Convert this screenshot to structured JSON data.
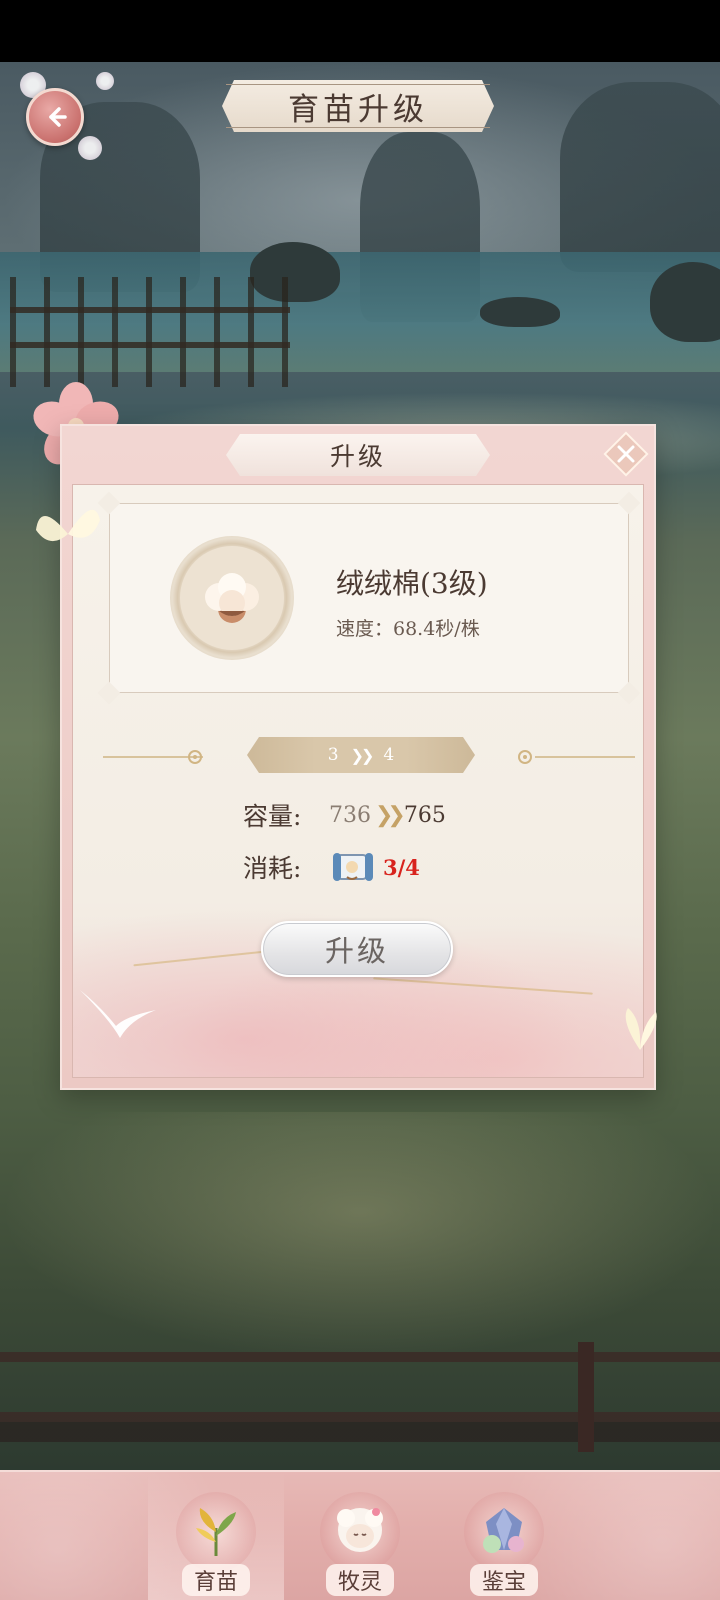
{
  "header": {
    "title": "育苗升级"
  },
  "dialog": {
    "title": "升级",
    "item": {
      "name": "绒绒棉(3级)",
      "speed": "速度：68.4秒/株"
    },
    "level": {
      "from": "3",
      "to": "4"
    },
    "capacity": {
      "label": "容量:",
      "old": "736",
      "new": "765"
    },
    "cost": {
      "label": "消耗:",
      "count": "3/4",
      "count_color": "#d8231d"
    },
    "upgrade_button_label": "升级"
  },
  "bottom_nav": {
    "active_index": 0,
    "items": [
      {
        "label": "育苗",
        "icon": "seedling-icon"
      },
      {
        "label": "牧灵",
        "icon": "sheep-icon"
      },
      {
        "label": "鉴宝",
        "icon": "gem-icon"
      }
    ]
  },
  "colors": {
    "accent_pink": "#e7b9b6",
    "title_text": "#4b3a32",
    "cost_red": "#d8231d"
  }
}
